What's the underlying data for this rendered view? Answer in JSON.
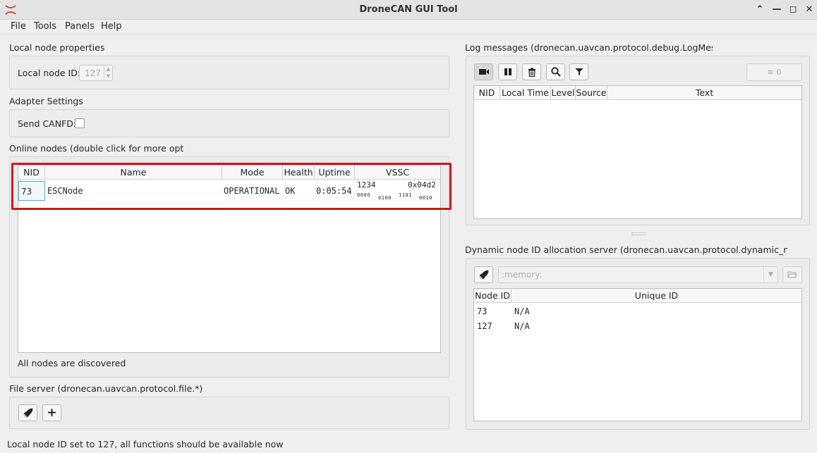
{
  "window": {
    "title": "DroneCAN GUI Tool"
  },
  "menu": [
    {
      "label": "File"
    },
    {
      "label": "Tools"
    },
    {
      "label": "Panels"
    },
    {
      "label": "Help"
    }
  ],
  "local_node": {
    "heading": "Local node properties",
    "id_label": "Local node ID:",
    "id_value": "127"
  },
  "adapter": {
    "heading": "Adapter Settings",
    "canfd_label": "Send CANFD:"
  },
  "online_nodes": {
    "heading": "Online nodes (double click for more options)",
    "columns": [
      "NID",
      "Name",
      "Mode",
      "Health",
      "Uptime",
      "VSSC"
    ],
    "rows": [
      {
        "nid": "73",
        "name": "ESCNode",
        "mode": "OPERATIONAL",
        "health": "OK",
        "uptime": "0:05:54",
        "vssc_dec": "1234",
        "vssc_hex": "0x04d2",
        "vssc_bits": [
          "0000",
          "0100",
          "1101",
          "0010"
        ]
      }
    ],
    "status": "All nodes are discovered"
  },
  "file_server": {
    "heading": "File server (dronecan.uavcan.protocol.file.*)"
  },
  "log": {
    "heading": "Log messages (dronecan.uavcan.protocol.debug.LogMessage)",
    "columns": [
      "NID",
      "Local Time",
      "Level",
      "Source",
      "Text"
    ],
    "count": "0"
  },
  "allocator": {
    "heading": "Dynamic node ID allocation server (dronecan.uavcan.protocol.dynamic_node_id.*)",
    "storage_placeholder": ":memory:",
    "columns": [
      "Node ID",
      "Unique ID"
    ],
    "rows": [
      {
        "node_id": "73",
        "unique_id": "N/A"
      },
      {
        "node_id": "127",
        "unique_id": "N/A"
      }
    ]
  },
  "statusbar": {
    "text": "Local node ID set to 127, all functions should be available now"
  },
  "colors": {
    "highlight": "#d1141b",
    "accent": "#3daee9"
  }
}
